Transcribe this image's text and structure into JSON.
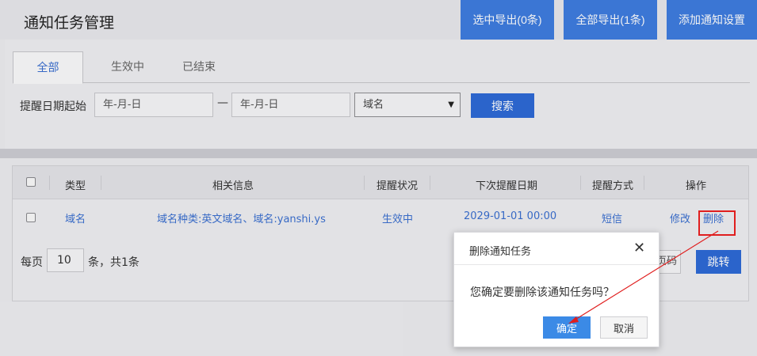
{
  "header": {
    "title": "通知任务管理",
    "export_selected": "选中导出(0条)",
    "export_all": "全部导出(1条)",
    "add_setting": "添加通知设置"
  },
  "tabs": [
    {
      "label": "全部",
      "active": true
    },
    {
      "label": "生效中",
      "active": false
    },
    {
      "label": "已结束",
      "active": false
    }
  ],
  "filter": {
    "date_label": "提醒日期起始",
    "date_start_placeholder": "年-月-日",
    "date_sep": "—",
    "date_end_placeholder": "年-月-日",
    "type_select": "域名",
    "search_button": "搜索"
  },
  "table": {
    "columns": [
      "类型",
      "相关信息",
      "提醒状况",
      "下次提醒日期",
      "提醒方式",
      "操作"
    ],
    "rows": [
      {
        "type": "域名",
        "info": "域名种类:英文域名、域名:yanshi.ys",
        "status": "生效中",
        "next_date": "2029-01-01 00:00",
        "method": "短信",
        "edit": "修改",
        "delete": "删除"
      }
    ]
  },
  "pagination": {
    "per_page_label": "每页",
    "per_page_value": "10",
    "total_text": "条，共1条",
    "goto_suffix": "页码",
    "goto_button": "跳转"
  },
  "dialog": {
    "title": "删除通知任务",
    "close": "✕",
    "message": "您确定要删除该通知任务吗？",
    "confirm": "确定",
    "cancel": "取消"
  },
  "colors": {
    "primary": "#3f7de0",
    "link": "#3a6fd0",
    "annotation": "#e01e1e"
  }
}
